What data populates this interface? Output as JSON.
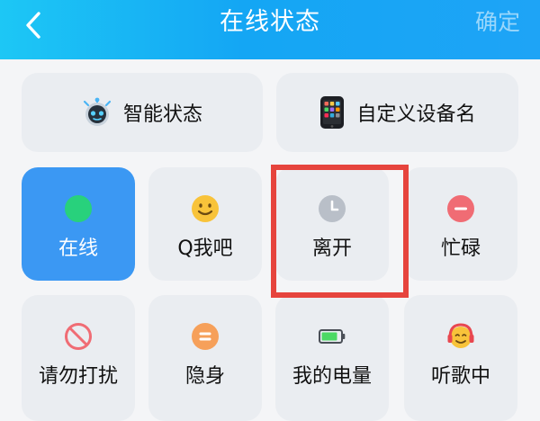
{
  "header": {
    "title": "在线状态",
    "confirm_label": "确定"
  },
  "top_options": [
    {
      "label": "智能状态",
      "icon": "robot-icon"
    },
    {
      "label": "自定义设备名",
      "icon": "phone-icon"
    }
  ],
  "statuses": [
    {
      "label": "在线",
      "icon": "green-dot-icon",
      "selected": true
    },
    {
      "label": "Q我吧",
      "icon": "smile-face-icon"
    },
    {
      "label": "离开",
      "icon": "clock-icon"
    },
    {
      "label": "忙碌",
      "icon": "minus-circle-icon"
    },
    {
      "label": "请勿打扰",
      "icon": "no-entry-icon"
    },
    {
      "label": "隐身",
      "icon": "equals-circle-icon"
    },
    {
      "label": "我的电量",
      "icon": "battery-icon"
    },
    {
      "label": "听歌中",
      "icon": "headphones-face-icon"
    }
  ],
  "colors": {
    "header_gradient_start": "#1dc7f5",
    "header_gradient_end": "#1ea4f6",
    "selected_tile": "#3b98f3",
    "tile_bg": "#eaedf1",
    "highlight": "#e6443d"
  }
}
